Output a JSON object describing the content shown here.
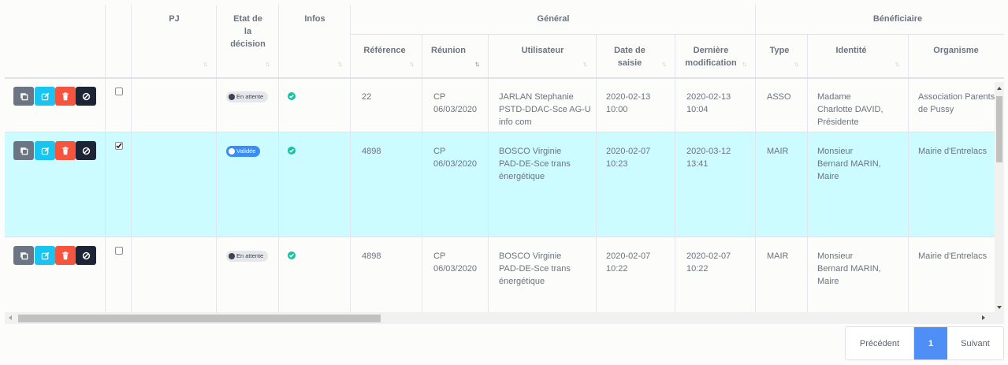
{
  "headers": {
    "pj": "PJ",
    "etat": [
      "Etat de",
      "la",
      "décision"
    ],
    "infos": "Infos",
    "general": "Général",
    "beneficiaire": "Bénéficiaire",
    "reference": "Référence",
    "reunion": "Réunion",
    "utilisateur": "Utilisateur",
    "date_saisie": [
      "Date de",
      "saisie"
    ],
    "derniere_modif": [
      "Dernière",
      "modification"
    ],
    "type": "Type",
    "identite": "Identité",
    "organisme": "Organisme"
  },
  "rows": [
    {
      "checked": false,
      "status": "En attente",
      "reference": "22",
      "reunion": [
        "CP",
        "06/03/2020"
      ],
      "utilisateur": [
        "JARLAN Stephanie",
        "PSTD-DDAC-Sce AG-U",
        "info com"
      ],
      "date_saisie": [
        "2020-02-13",
        "10:00"
      ],
      "derniere_modif": [
        "2020-02-13",
        "10:04"
      ],
      "type": "ASSO",
      "identite": [
        "Madame",
        "Charlotte DAVID,",
        "Présidente"
      ],
      "organisme": [
        "Association Parents",
        "de Pussy"
      ]
    },
    {
      "checked": true,
      "status": "Validée",
      "reference": "4898",
      "reunion": [
        "CP",
        "06/03/2020"
      ],
      "utilisateur": [
        "BOSCO Virginie",
        "PAD-DE-Sce trans",
        "énergétique"
      ],
      "date_saisie": [
        "2020-02-07",
        "10:23"
      ],
      "derniere_modif": [
        "2020-03-12",
        "13:41"
      ],
      "type": "MAIR",
      "identite": [
        "Monsieur",
        "Bernard MARIN,",
        "Maire"
      ],
      "organisme": [
        "Mairie d'Entrelacs"
      ]
    },
    {
      "checked": false,
      "status": "En attente",
      "reference": "4898",
      "reunion": [
        "CP",
        "06/03/2020"
      ],
      "utilisateur": [
        "BOSCO Virginie",
        "PAD-DE-Sce trans",
        "énergétique"
      ],
      "date_saisie": [
        "2020-02-07",
        "10:22"
      ],
      "derniere_modif": [
        "2020-02-07",
        "10:22"
      ],
      "type": "MAIR",
      "identite": [
        "Monsieur",
        "Bernard MARIN,",
        "Maire"
      ],
      "organisme": [
        "Mairie d'Entrelacs"
      ]
    }
  ],
  "pagination": {
    "previous": "Précédent",
    "current": "1",
    "next": "Suivant"
  },
  "colors": {
    "copy": "#6c7584",
    "edit": "#17c5f0",
    "delete": "#f5543e",
    "disable": "#1d2435",
    "selected_row": "#ccfcff",
    "badge_pending_bg": "#e5e7ea",
    "badge_valid_bg": "#3b8cf3",
    "info_ok": "#16c2a4",
    "page_active": "#4f8ef7"
  }
}
